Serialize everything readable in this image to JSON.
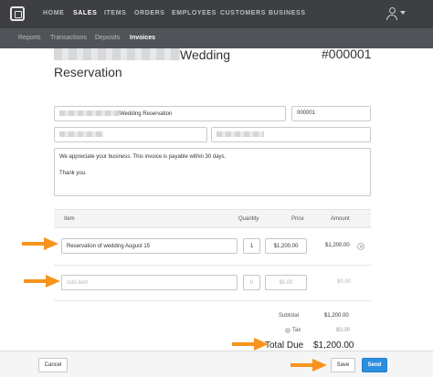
{
  "topnav": {
    "items": [
      "HOME",
      "SALES",
      "ITEMS",
      "ORDERS",
      "EMPLOYEES",
      "CUSTOMERS",
      "BUSINESS"
    ],
    "active": "SALES"
  },
  "subnav": {
    "items": [
      "Reports",
      "Transactions",
      "Deposits",
      "Invoices"
    ],
    "active": "Invoices"
  },
  "invoice": {
    "title_suffix": "Wedding",
    "title_line2": "Reservation",
    "number": "#000001"
  },
  "form": {
    "title_field_value": "Wedding Reservation",
    "number_field_value": "000001",
    "message_line1": "We appreciate your business. This invoice is payable within 30 days.",
    "message_line2": "Thank you."
  },
  "table": {
    "headers": {
      "item": "Item",
      "quantity": "Quantity",
      "price": "Price",
      "amount": "Amount"
    },
    "rows": [
      {
        "item": "Reservation of wedding August 15",
        "quantity": "1",
        "price": "$1,200.00",
        "amount": "$1,200.00"
      }
    ],
    "new_row": {
      "placeholder": "Add item",
      "quantity": "0",
      "price": "$0.00",
      "amount": "$0.00"
    }
  },
  "summary": {
    "subtotal_label": "Subtotal",
    "subtotal_value": "$1,200.00",
    "tax_label": "Tax",
    "tax_value": "$0.00",
    "total_label": "Total Due",
    "total_value": "$1,200.00"
  },
  "footer": {
    "cancel": "Cancel",
    "save": "Save",
    "send": "Send"
  },
  "colors": {
    "topnav_bg": "#3d3f43",
    "subnav_bg": "#505357",
    "send_button": "#2b8fe0",
    "annotation_arrow": "#f7941d"
  }
}
